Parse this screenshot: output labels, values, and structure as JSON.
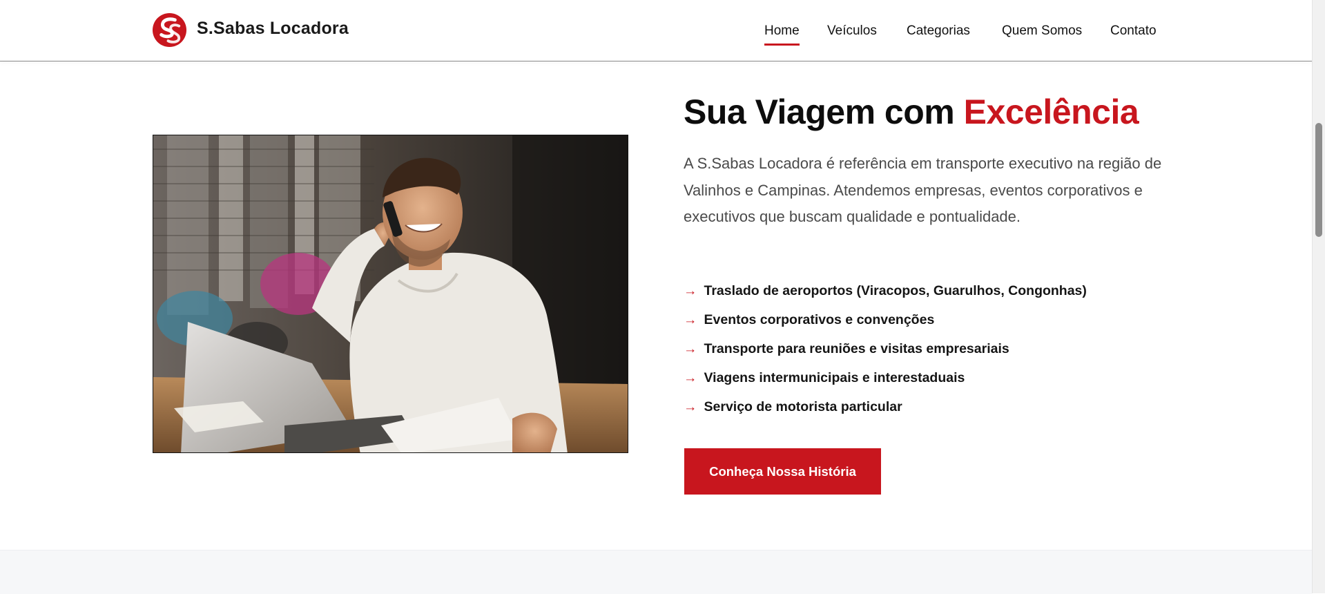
{
  "header": {
    "brand_name": "S.Sabas Locadora",
    "logo_icon": "ss-logo-icon",
    "nav": [
      {
        "label": "Home",
        "active": true
      },
      {
        "label": "Veículos",
        "active": false
      },
      {
        "label": "Categorias",
        "active": false
      },
      {
        "label": "Quem Somos",
        "active": false
      },
      {
        "label": "Contato",
        "active": false
      }
    ]
  },
  "hero": {
    "title_main": "Sua Viagem com ",
    "title_accent": "Excelência",
    "description": "A S.Sabas Locadora é referência em transporte executivo na região de Valinhos e Campinas. Atendemos empresas, eventos corporativos e executivos que buscam qualidade e pontualidade.",
    "features": [
      "Traslado de aeroportos (Viracopos, Guarulhos, Congonhas)",
      "Eventos corporativos e convenções",
      "Transporte para reuniões e visitas empresariais",
      "Viagens intermunicipais e interestaduais",
      "Serviço de motorista particular"
    ],
    "feature_icon": "arrow-right-icon",
    "arrow_glyph": "→",
    "cta_label": "Conheça Nossa História"
  },
  "colors": {
    "accent": "#c8161e",
    "text": "#0d0d0d",
    "muted": "#4a4a4a"
  }
}
